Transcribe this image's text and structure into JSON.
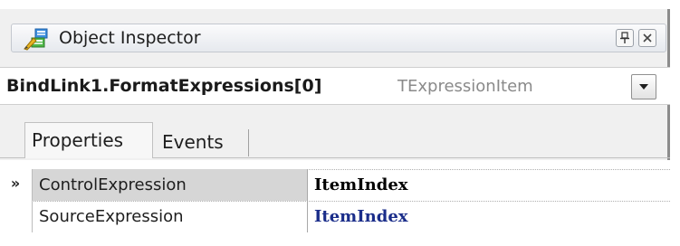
{
  "window": {
    "title": "Object Inspector",
    "icons": {
      "title": "object-inspector-icon",
      "pin": "pin-icon",
      "close": "close-icon"
    }
  },
  "selector": {
    "object_name": "BindLink1.FormatExpressions[0]",
    "object_type": "TExpressionItem",
    "dropdown_icon": "chevron-down-icon"
  },
  "tabs": [
    {
      "label": "Properties",
      "active": true
    },
    {
      "label": "Events",
      "active": false
    }
  ],
  "properties": [
    {
      "marker": "»",
      "name": "ControlExpression",
      "value": "ItemIndex",
      "selected": true
    },
    {
      "marker": "",
      "name": "SourceExpression",
      "value": "ItemIndex",
      "selected": false
    }
  ],
  "colors": {
    "selected_row": "#d6d6d6",
    "value_default": "#000000",
    "value_modified": "#1a2d8a",
    "type_text": "#8a8a8a"
  }
}
